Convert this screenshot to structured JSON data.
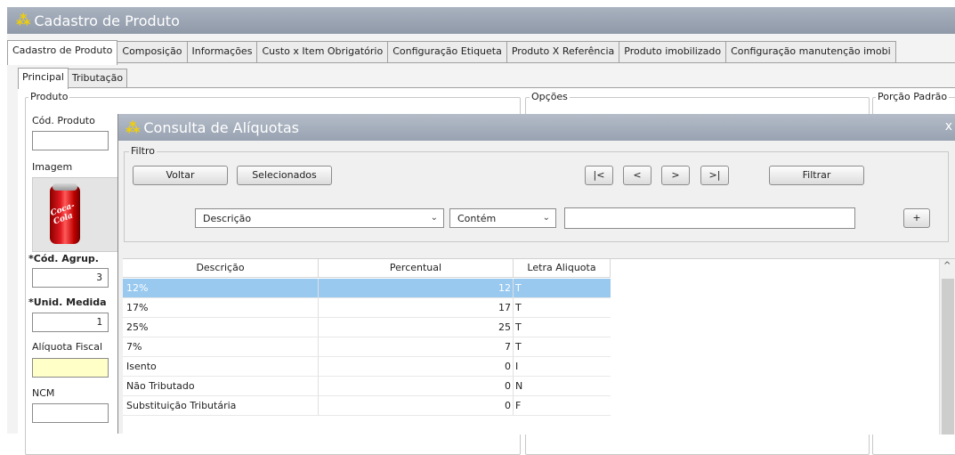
{
  "window": {
    "title": "Cadastro de Produto"
  },
  "main_tabs": [
    {
      "label": "Cadastro de Produto",
      "active": true
    },
    {
      "label": "Composição",
      "active": false
    },
    {
      "label": "Informações",
      "active": false
    },
    {
      "label": "Custo x Item Obrigatório",
      "active": false
    },
    {
      "label": "Configuração Etiqueta",
      "active": false
    },
    {
      "label": "Produto X Referência",
      "active": false
    },
    {
      "label": "Produto imobilizado",
      "active": false
    },
    {
      "label": "Configuração manutenção imobi",
      "active": false
    }
  ],
  "sub_tabs": [
    {
      "label": "Principal",
      "active": true
    },
    {
      "label": "Tributação",
      "active": false
    }
  ],
  "groups": {
    "produto": "Produto",
    "opcoes": "Opções",
    "porcao": "Porção Padrão"
  },
  "fields": {
    "cod_produto_label": "Cód. Produto",
    "cod_produto_value": "",
    "imagem_label": "Imagem",
    "image_text": "Coca-Cola",
    "cod_agrup_label": "*Cód. Agrup.",
    "cod_agrup_value": "3",
    "unid_medida_label": "*Unid. Medida",
    "unid_medida_value": "1",
    "aliquota_fiscal_label": "Alíquota Fiscal",
    "aliquota_fiscal_value": "",
    "ncm_label": "NCM",
    "ncm_value": ""
  },
  "dialog": {
    "title": "Consulta de Alíquotas",
    "close": "x",
    "filter_group": "Filtro",
    "buttons": {
      "voltar": "Voltar",
      "selecionados": "Selecionados",
      "first": "|<",
      "prev": "<",
      "next": ">",
      "last": ">|",
      "filtrar": "Filtrar",
      "add": "+"
    },
    "field_select": "Descrição",
    "operator_select": "Contém",
    "filter_text": "",
    "columns": [
      "Descrição",
      "Percentual",
      "Letra Aliquota"
    ],
    "rows": [
      {
        "descricao": "12%",
        "percentual": "12",
        "letra": "T",
        "selected": true
      },
      {
        "descricao": "17%",
        "percentual": "17",
        "letra": "T",
        "selected": false
      },
      {
        "descricao": "25%",
        "percentual": "25",
        "letra": "T",
        "selected": false
      },
      {
        "descricao": "7%",
        "percentual": "7",
        "letra": "T",
        "selected": false
      },
      {
        "descricao": "Isento",
        "percentual": "0",
        "letra": "I",
        "selected": false
      },
      {
        "descricao": "Não Tributado",
        "percentual": "0",
        "letra": "N",
        "selected": false
      },
      {
        "descricao": "Substituição Tributária",
        "percentual": "0",
        "letra": "F",
        "selected": false
      }
    ]
  },
  "colors": {
    "title_bar": "#98a2b1",
    "selected_row": "#99c9ef",
    "required_field": "#ffffc8",
    "logo": "#f5d000"
  },
  "icons": {
    "app_logo": "sparkle-logo-icon",
    "dropdown": "chevron-down-icon",
    "scroll_up": "chevron-up-icon"
  }
}
